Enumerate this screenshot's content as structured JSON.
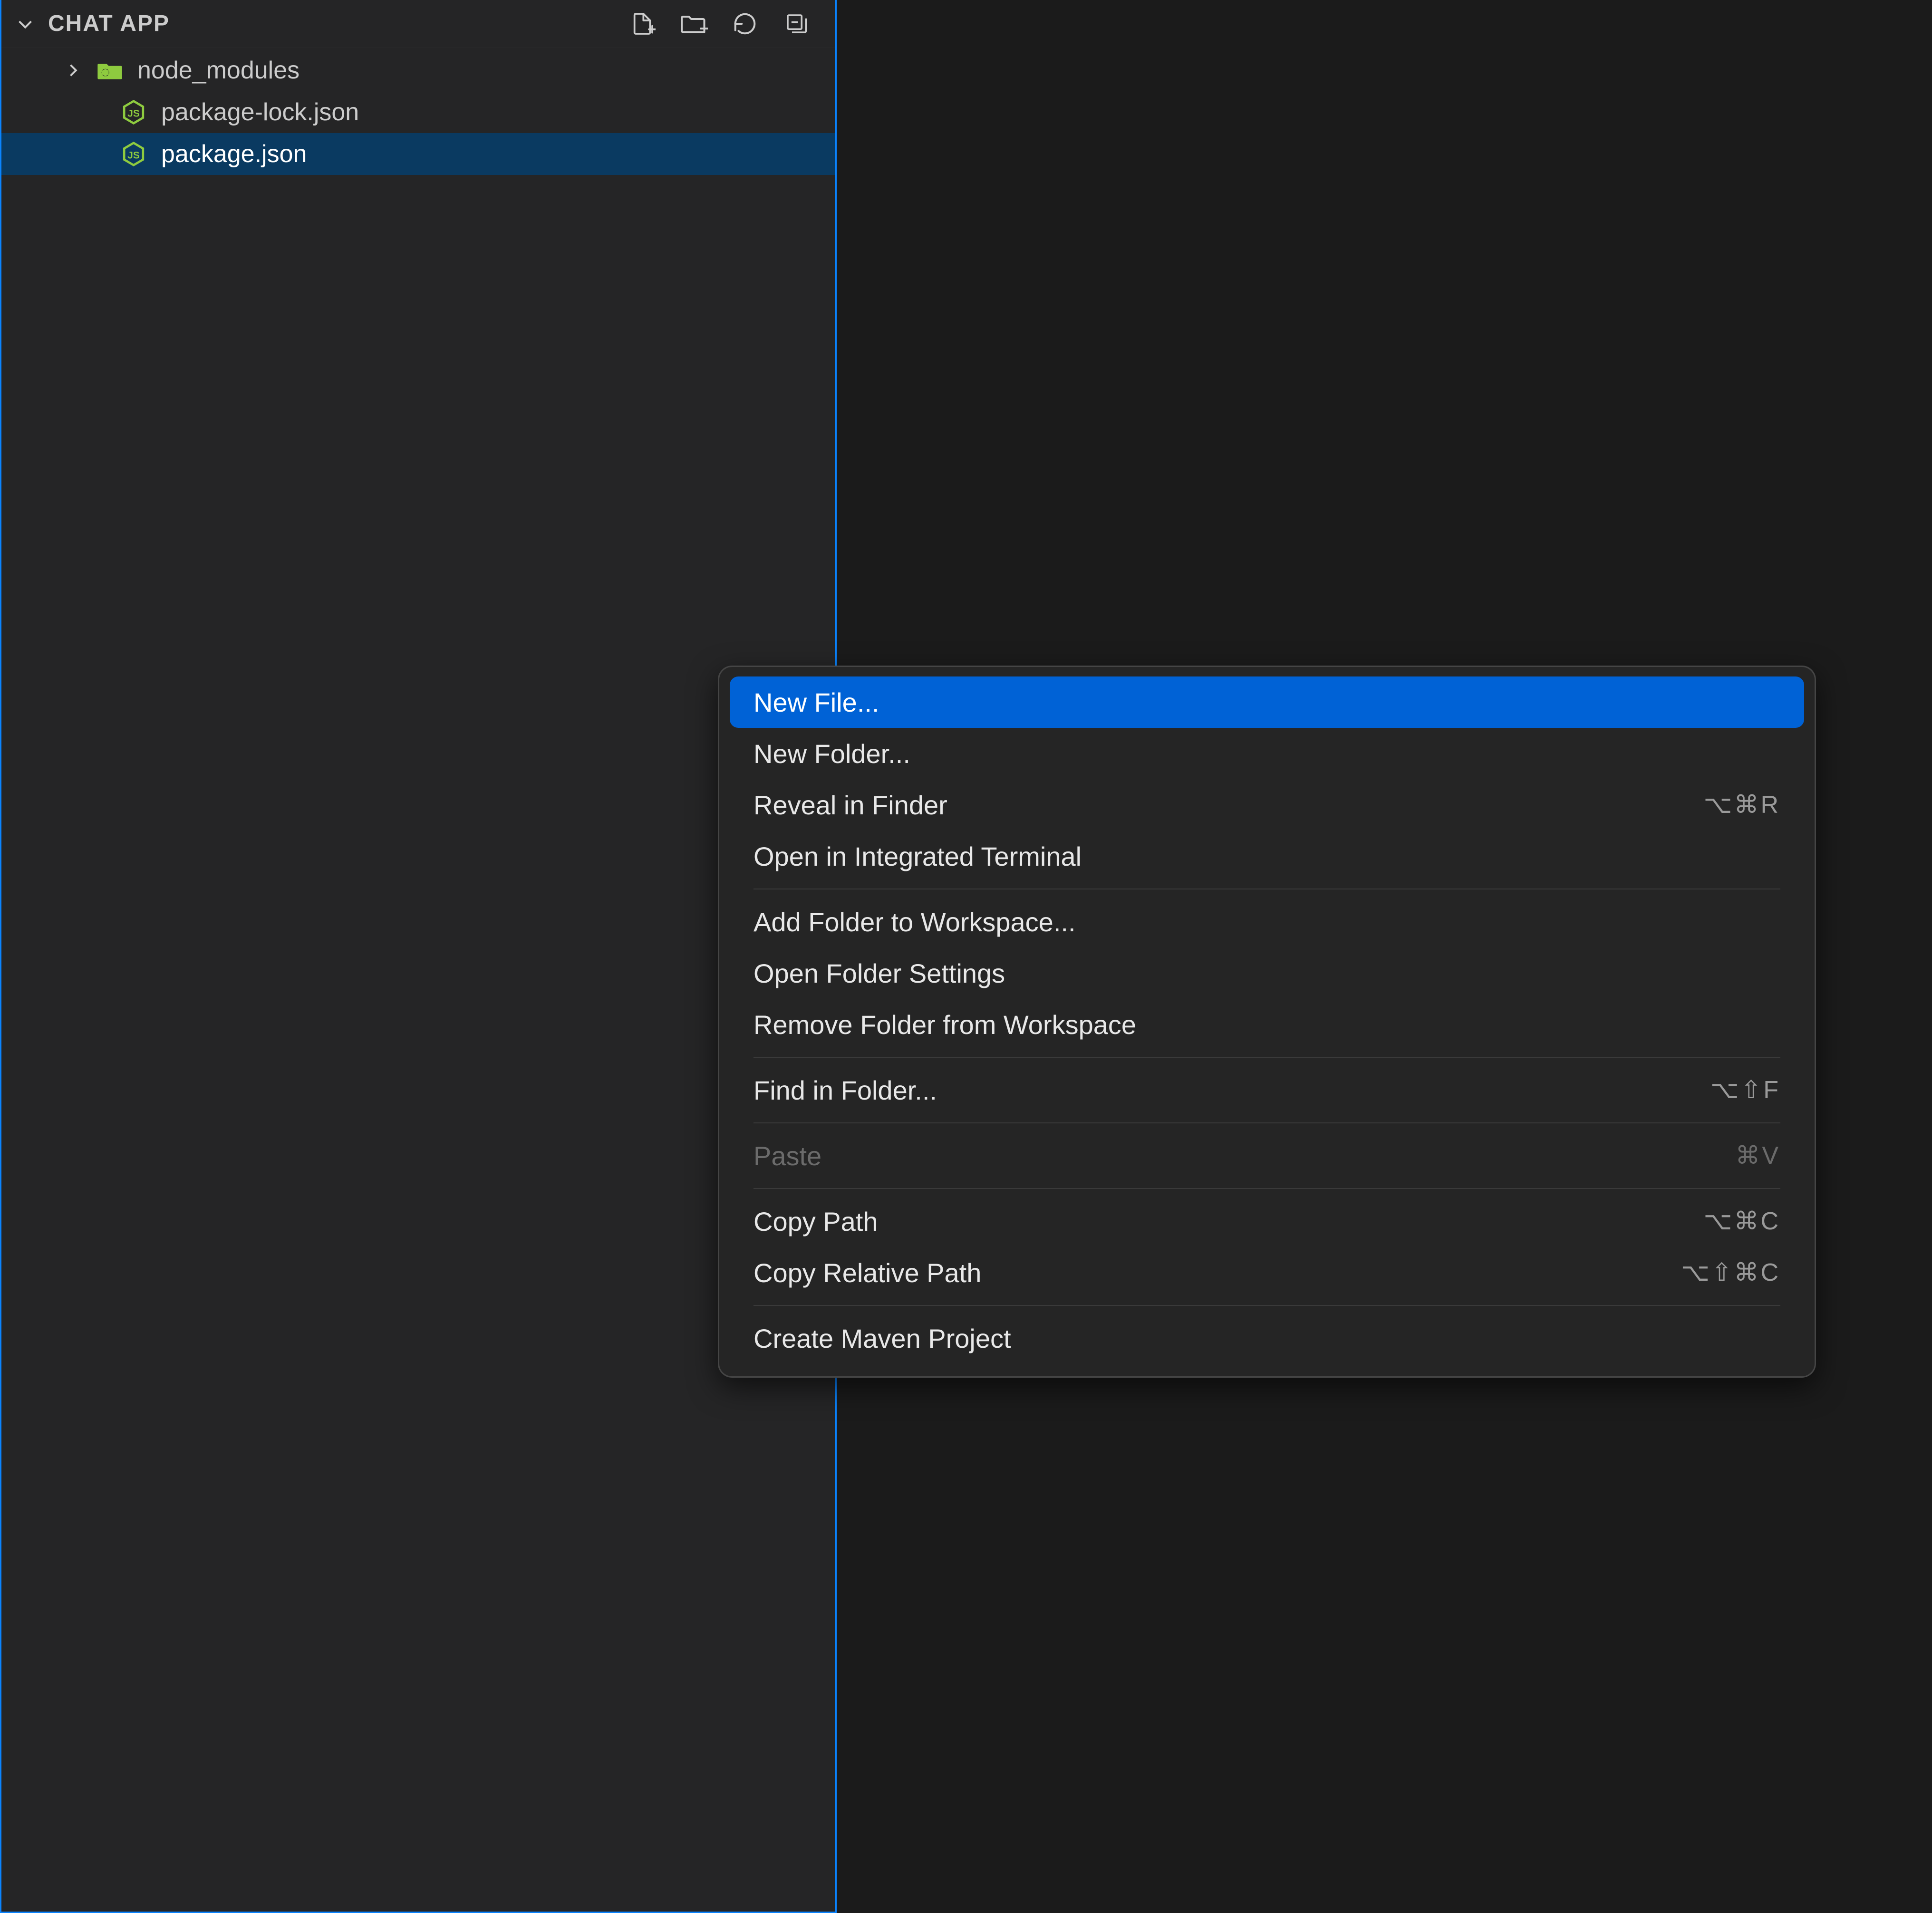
{
  "explorer": {
    "title": "CHAT APP",
    "actions": {
      "new_file_icon": "new-file",
      "new_folder_icon": "new-folder",
      "refresh_icon": "refresh",
      "collapse_icon": "collapse-all"
    },
    "tree": [
      {
        "type": "folder",
        "label": "node_modules",
        "expanded": false,
        "icon": "folder-green"
      },
      {
        "type": "file",
        "label": "package-lock.json",
        "icon": "node",
        "selected": false
      },
      {
        "type": "file",
        "label": "package.json",
        "icon": "node",
        "selected": true
      }
    ]
  },
  "context_menu": {
    "groups": [
      [
        {
          "label": "New File...",
          "shortcut": "",
          "highlight": true,
          "disabled": false
        },
        {
          "label": "New Folder...",
          "shortcut": "",
          "highlight": false,
          "disabled": false
        },
        {
          "label": "Reveal in Finder",
          "shortcut": "⌥⌘R",
          "highlight": false,
          "disabled": false
        },
        {
          "label": "Open in Integrated Terminal",
          "shortcut": "",
          "highlight": false,
          "disabled": false
        }
      ],
      [
        {
          "label": "Add Folder to Workspace...",
          "shortcut": "",
          "highlight": false,
          "disabled": false
        },
        {
          "label": "Open Folder Settings",
          "shortcut": "",
          "highlight": false,
          "disabled": false
        },
        {
          "label": "Remove Folder from Workspace",
          "shortcut": "",
          "highlight": false,
          "disabled": false
        }
      ],
      [
        {
          "label": "Find in Folder...",
          "shortcut": "⌥⇧F",
          "highlight": false,
          "disabled": false
        }
      ],
      [
        {
          "label": "Paste",
          "shortcut": "⌘V",
          "highlight": false,
          "disabled": true
        }
      ],
      [
        {
          "label": "Copy Path",
          "shortcut": "⌥⌘C",
          "highlight": false,
          "disabled": false
        },
        {
          "label": "Copy Relative Path",
          "shortcut": "⌥⇧⌘C",
          "highlight": false,
          "disabled": false
        }
      ],
      [
        {
          "label": "Create Maven Project",
          "shortcut": "",
          "highlight": false,
          "disabled": false
        }
      ]
    ]
  }
}
